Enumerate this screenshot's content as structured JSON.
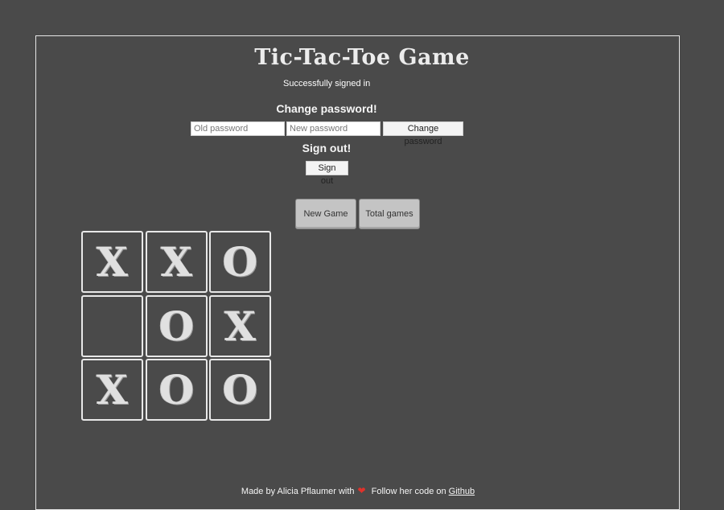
{
  "header": {
    "title": "Tic-Tac-Toe Game",
    "status": "Successfully signed in"
  },
  "change_password": {
    "heading": "Change password!",
    "old_placeholder": "Old password",
    "new_placeholder": "New password",
    "button_label": "Change password"
  },
  "sign_out": {
    "heading": "Sign out!",
    "button_label": "Sign out"
  },
  "game_buttons": {
    "new_game": "New Game",
    "total_games": "Total games"
  },
  "board": {
    "cells": [
      "X",
      "X",
      "O",
      "",
      "O",
      "X",
      "X",
      "O",
      "O"
    ]
  },
  "footer": {
    "made_by": "Made by Alicia Pflaumer with",
    "heart_icon": "heart-icon",
    "follow": "Follow her code on",
    "link_text": "Github"
  },
  "colors": {
    "background": "#4a4a4a",
    "frame_border": "#e6e6e6",
    "heart": "#e0322b",
    "big_button": "#c4c4c4"
  }
}
